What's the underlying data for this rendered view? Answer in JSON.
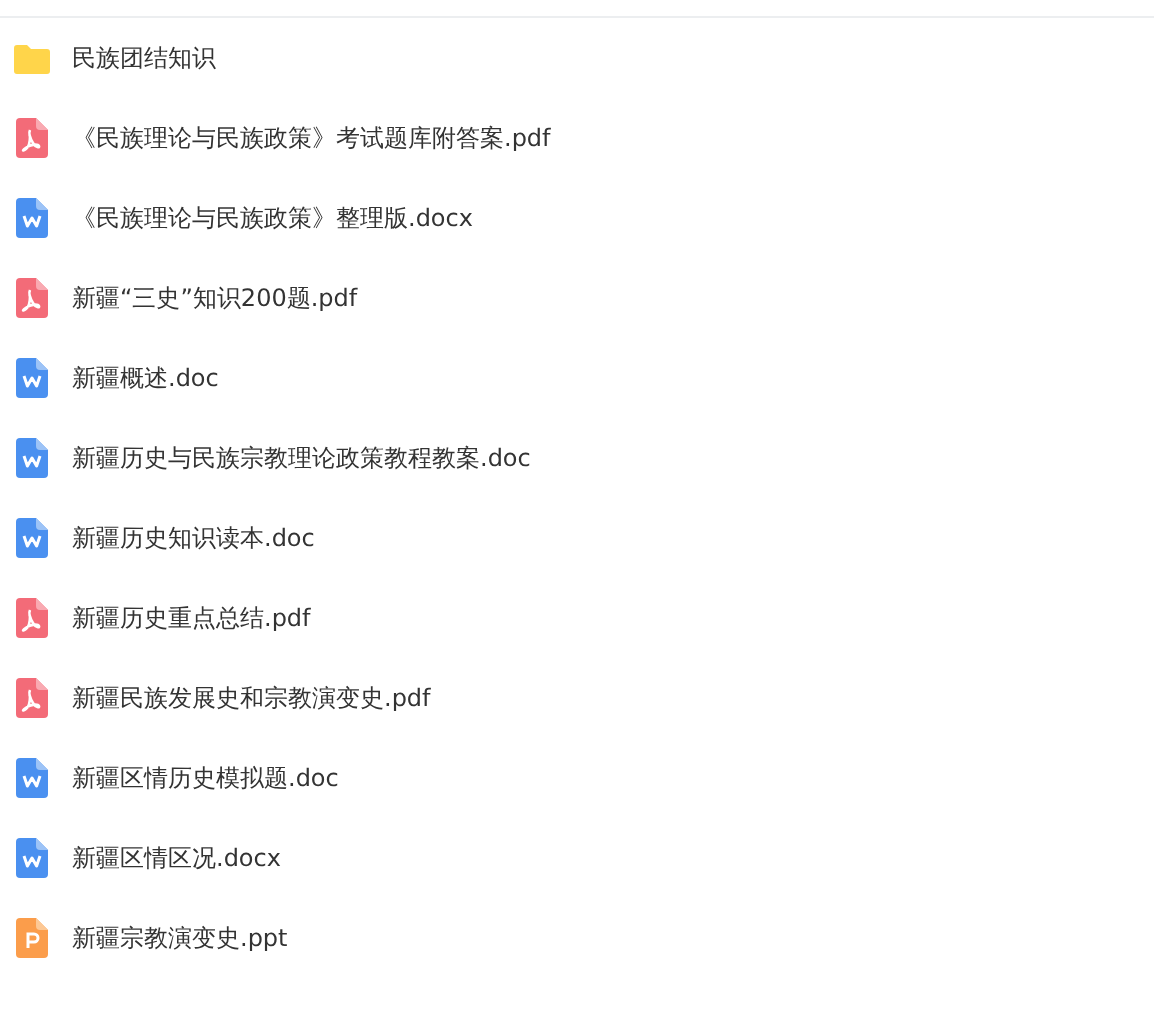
{
  "files": [
    {
      "kind": "folder",
      "name": "民族团结知识"
    },
    {
      "kind": "pdf",
      "name": "《民族理论与民族政策》考试题库附答案.pdf"
    },
    {
      "kind": "word",
      "name": "《民族理论与民族政策》整理版.docx"
    },
    {
      "kind": "pdf",
      "name": "新疆“三史”知识200题.pdf"
    },
    {
      "kind": "word",
      "name": "新疆概述.doc"
    },
    {
      "kind": "word",
      "name": "新疆历史与民族宗教理论政策教程教案.doc"
    },
    {
      "kind": "word",
      "name": "新疆历史知识读本.doc"
    },
    {
      "kind": "pdf",
      "name": "新疆历史重点总结.pdf"
    },
    {
      "kind": "pdf",
      "name": "新疆民族发展史和宗教演变史.pdf"
    },
    {
      "kind": "word",
      "name": "新疆区情历史模拟题.doc"
    },
    {
      "kind": "word",
      "name": "新疆区情区况.docx"
    },
    {
      "kind": "ppt",
      "name": "新疆宗教演变史.ppt"
    }
  ]
}
